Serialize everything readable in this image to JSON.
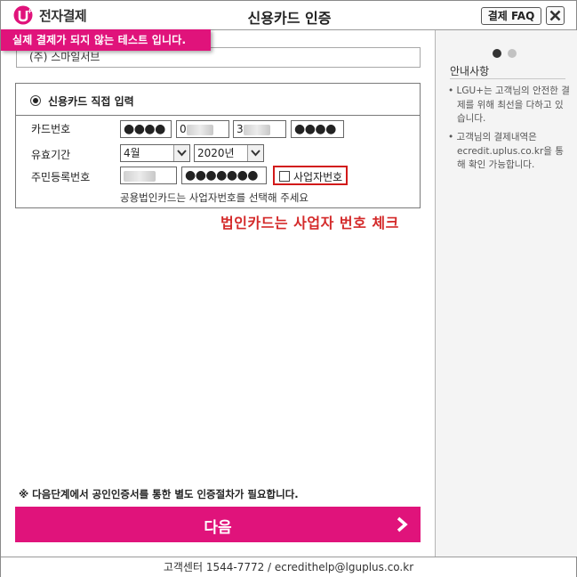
{
  "header": {
    "logo_text": "전자결제",
    "title": "신용카드 인증",
    "faq_label": "결제 FAQ"
  },
  "test_banner": "실제 결제가 되지 않는 테스트 입니다.",
  "merchant": "(주) 스마일서브",
  "form": {
    "radio_label": "신용카드 직접 입력",
    "card_label": "카드번호",
    "card_parts": [
      "●●●●",
      "0",
      "3",
      "●●●●"
    ],
    "expiry_label": "유효기간",
    "month_value": "4월",
    "year_value": "2020년",
    "rrn_label": "주민등록번호",
    "rrn_back": "●●●●●●●",
    "biz_label": "사업자번호",
    "hint": "공용법인카드는 사업자번호를 선택해 주세요"
  },
  "red_note": "법인카드는 사업자 번호 체크",
  "bottom_notice": "※ 다음단계에서 공인인증서를 통한 별도 인증절차가 필요합니다.",
  "next_label": "다음",
  "sidebar": {
    "notice_title": "안내사항",
    "notices": [
      "• LGU+는 고객님의 안전한 결제를 위해 최선을 다하고 있습니다.",
      "• 고객님의 결제내역은 ecredit.uplus.co.kr을 통해 확인 가능합니다."
    ]
  },
  "footer": "고객센터 1544-7772 / ecredithelp@lguplus.co.kr",
  "colors": {
    "accent": "#e0137b",
    "warning": "#d42a2a"
  }
}
